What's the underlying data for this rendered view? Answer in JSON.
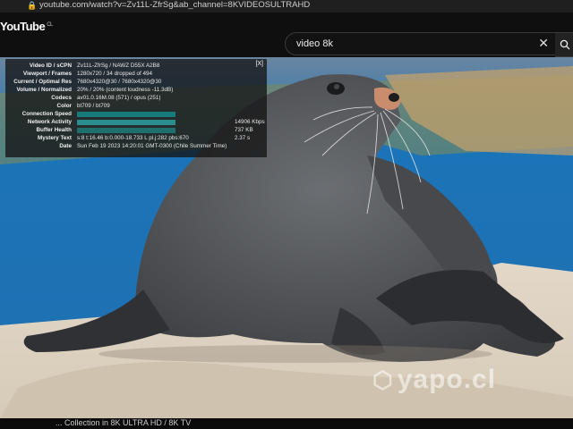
{
  "browser": {
    "url": "youtube.com/watch?v=Zv11L-ZfrSg&ab_channel=8KVIDEOSULTRAHD"
  },
  "masthead": {
    "logo_text": "YouTube",
    "country_code": "CL",
    "search_value": "video 8k",
    "clear_symbol": "✕"
  },
  "stats": {
    "close_label": "[X]",
    "rows": [
      {
        "label": "Video ID / sCPN",
        "value": "Zv11L-ZfrSg / NAWZ D55X A2B8"
      },
      {
        "label": "Viewport / Frames",
        "value": "1280x720 / 34 dropped of 494"
      },
      {
        "label": "Current / Optimal Res",
        "value": "7680x4320@30 / 7680x4320@30"
      },
      {
        "label": "Volume / Normalized",
        "value": "20% / 20% (content loudness -11.3dB)"
      },
      {
        "label": "Codecs",
        "value": "av01.0.16M.08 (571) / opus (251)"
      },
      {
        "label": "Color",
        "value": "bt709 / bt709"
      },
      {
        "label": "Connection Speed",
        "value": ""
      },
      {
        "label": "Network Activity",
        "value": "14906 Kbps"
      },
      {
        "label": "Buffer Health",
        "value": "737 KB"
      },
      {
        "label": "Mystery Text",
        "value": "2.37 s"
      },
      {
        "label": "Date",
        "value": "Sun Feb 19 2023 14:20:01 GMT-0300 (Chile Summer Time)"
      }
    ],
    "mystery_text": "s:8 t:16.46 b:0.000-18.733 L pl.j:282 pbs:670"
  },
  "bottom_title": "... Collection in 8K ULTRA HD / 8K TV",
  "watermark": "yapo.cl",
  "colors": {
    "stats_bar": "#157b7b",
    "background": "#0d0d0d"
  }
}
